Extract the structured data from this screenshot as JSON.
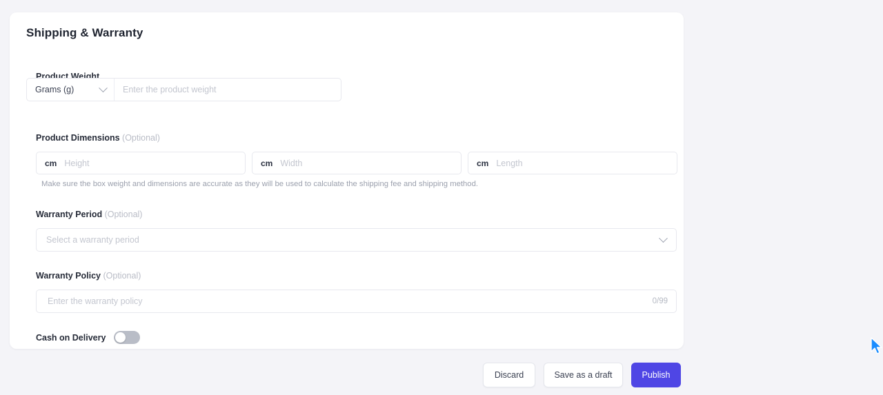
{
  "card": {
    "title": "Shipping & Warranty"
  },
  "product_weight": {
    "label": "Product Weight",
    "unit_value": "Grams (g)",
    "unit_icon": "chevron-down-icon",
    "placeholder": "Enter the product weight",
    "value": ""
  },
  "product_dimensions": {
    "label": "Product Dimensions",
    "optional": "(Optional)",
    "unit": "cm",
    "fields": [
      {
        "name": "height",
        "placeholder": "Height",
        "value": ""
      },
      {
        "name": "width",
        "placeholder": "Width",
        "value": ""
      },
      {
        "name": "length",
        "placeholder": "Length",
        "value": ""
      }
    ],
    "helper_text": "Make sure the box weight and dimensions are accurate as they will be used to calculate the shipping fee and shipping method."
  },
  "warranty_period": {
    "label": "Warranty Period",
    "optional": "(Optional)",
    "placeholder": "Select a warranty period",
    "value": "",
    "icon": "chevron-down-icon"
  },
  "warranty_policy": {
    "label": "Warranty Policy",
    "optional": "(Optional)",
    "placeholder": "Enter the warranty policy",
    "value": "",
    "counter": "0/99"
  },
  "cash_on_delivery": {
    "label": "Cash on Delivery",
    "enabled": false
  },
  "footer": {
    "discard_label": "Discard",
    "draft_label": "Save as a draft",
    "publish_label": "Publish"
  },
  "colors": {
    "page_background": "#f4f4f8",
    "card_background": "#ffffff",
    "primary": "#4f46e5",
    "border": "#e7e8ee",
    "placeholder": "#c3c6cf",
    "label": "#262b38",
    "optional": "#b9bcc6",
    "helper": "#9ba0ad",
    "toggle_off": "#b9bdc7",
    "cursor": "#1a8cff"
  }
}
